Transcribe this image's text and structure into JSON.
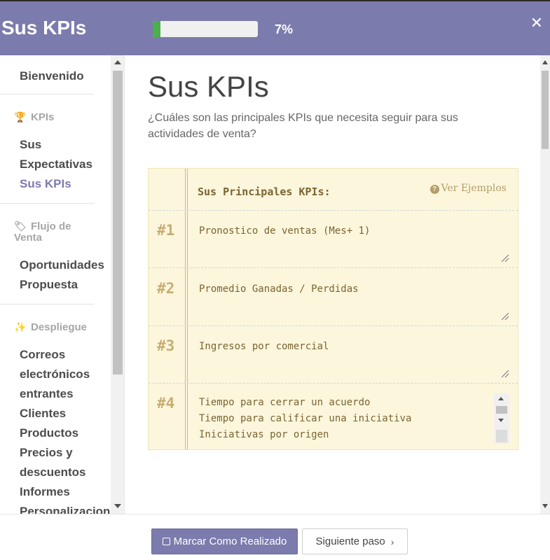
{
  "header": {
    "title": "Sus KPIs",
    "progress_percent": 7,
    "progress_label": "7%",
    "close_label": "✕"
  },
  "sidebar": {
    "welcome": "Bienvenido",
    "sections": [
      {
        "category": "KPIs",
        "icon": "trophy-icon",
        "items": [
          "Sus Expectativas",
          "Sus KPIs"
        ],
        "active_item": "Sus KPIs"
      },
      {
        "category": "Flujo de Venta",
        "icon": "tag-icon",
        "items": [
          "Oportunidades",
          "Propuesta"
        ]
      },
      {
        "category": "Despliegue",
        "icon": "magic-wand-icon",
        "items": [
          "Correos electrónicos entrantes",
          "Clientes",
          "Productos",
          "Precios y descuentos",
          "Informes",
          "Personalizacion"
        ]
      }
    ]
  },
  "main": {
    "title": "Sus KPIs",
    "description": "¿Cuáles son las principales KPIs que necesita seguir para sus actividades de venta?",
    "notebook": {
      "heading": "Sus Principales KPIs:",
      "examples_label": "Ver Ejemplos",
      "kpis": [
        {
          "num": "#1",
          "text": "Pronostico de ventas (Mes+ 1)"
        },
        {
          "num": "#2",
          "text": "Promedio Ganadas / Perdidas"
        },
        {
          "num": "#3",
          "text": "Ingresos por comercial"
        },
        {
          "num": "#4",
          "text": "Tiempo para cerrar un acuerdo\nTiempo para calificar una iniciativa\nIniciativas por origen"
        }
      ]
    }
  },
  "footer": {
    "done_label": "Marcar Como Realizado",
    "next_label": "Siguiente paso"
  },
  "colors": {
    "accent": "#7c7bad",
    "progress": "#4cae4c",
    "notebook_bg": "#fcf6dd",
    "notebook_text": "#7a6531",
    "kpi_number": "#c8ad73"
  }
}
